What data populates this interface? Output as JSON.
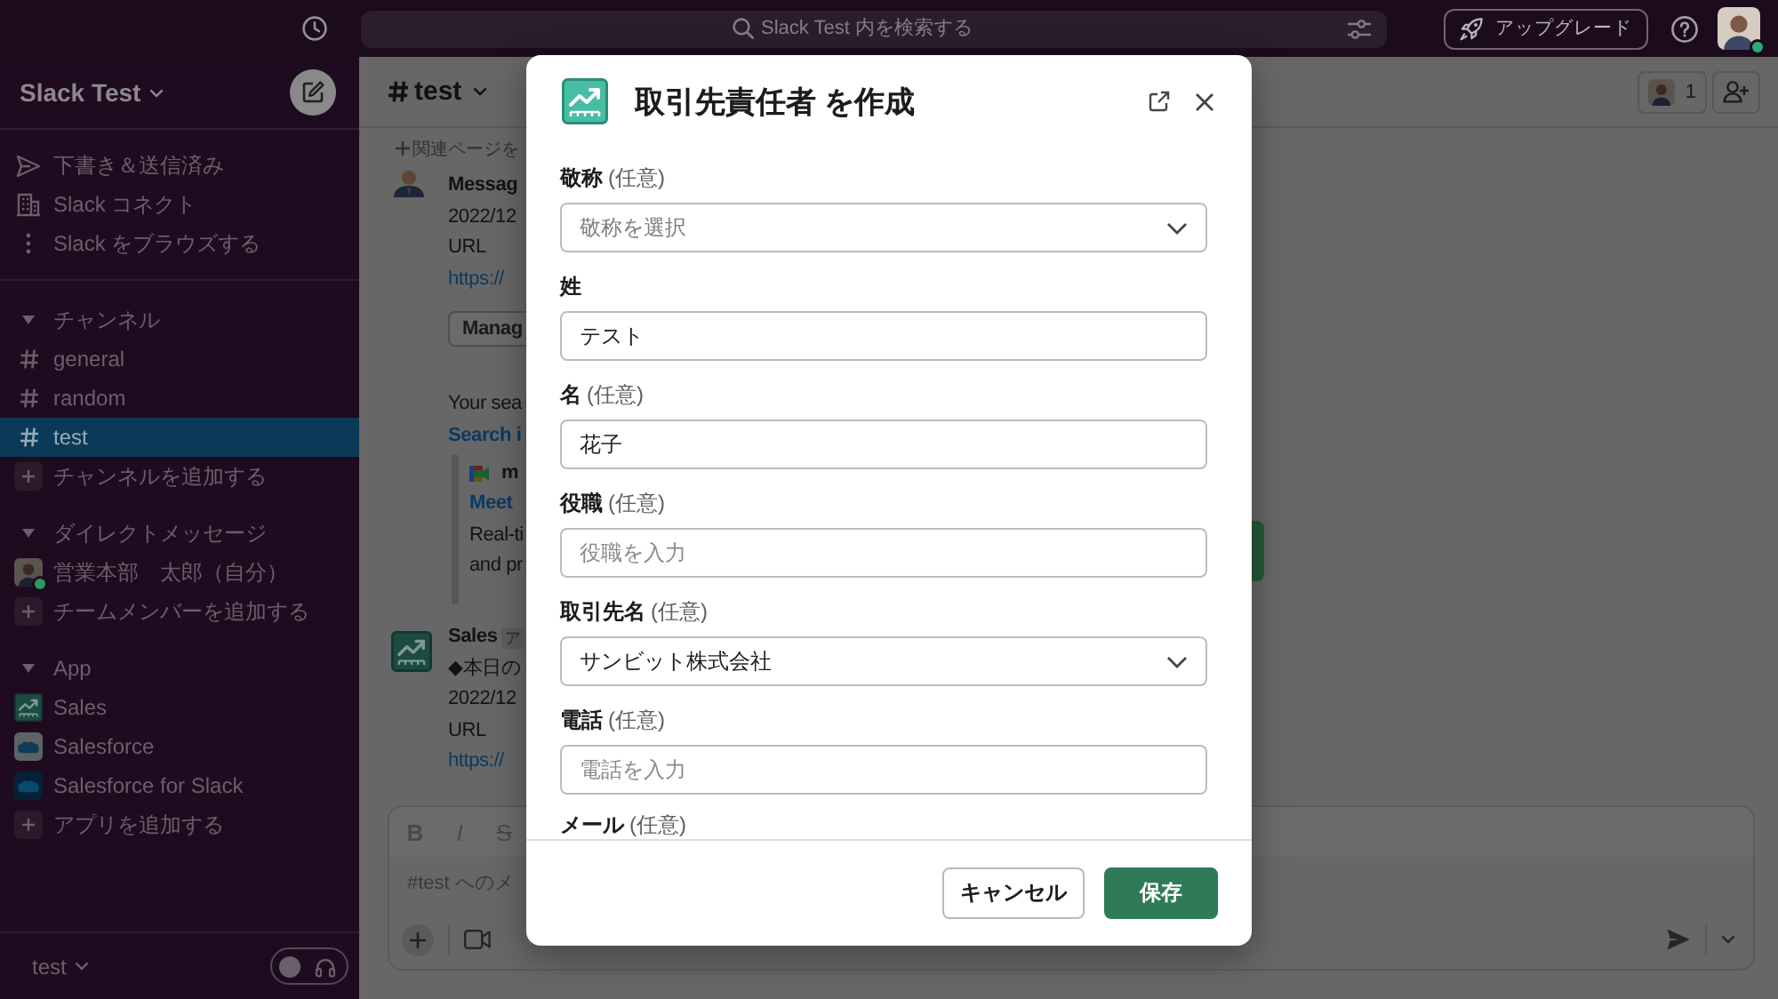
{
  "topbar": {
    "search": {
      "placeholder": "Slack Test 内を検索する"
    },
    "upgrade_button": "アップグレード",
    "user": {
      "online": true
    }
  },
  "sidebar": {
    "workspace": "Slack Test",
    "nav": [
      {
        "label": "下書き＆送信済み",
        "selected": false
      },
      {
        "label": "Slack コネクト",
        "selected": false
      },
      {
        "label": "Slack をブラウズする",
        "selected": false
      }
    ],
    "sections": [
      {
        "title": "チャンネル",
        "expanded": true,
        "items": [
          {
            "kind": "channel",
            "label": "general",
            "selected": false
          },
          {
            "kind": "channel",
            "label": "random",
            "selected": false
          },
          {
            "kind": "channel",
            "label": "test",
            "selected": true
          },
          {
            "kind": "add",
            "label": "チャンネルを追加する",
            "selected": false
          }
        ]
      },
      {
        "title": "ダイレクトメッセージ",
        "expanded": true,
        "items": [
          {
            "kind": "user",
            "label": "営業本部　太郎（自分）",
            "online": true,
            "selected": false
          },
          {
            "kind": "add",
            "label": "チームメンバーを追加する",
            "selected": false
          }
        ]
      },
      {
        "title": "App",
        "expanded": true,
        "items": [
          {
            "kind": "app",
            "label": "Sales",
            "selected": false
          },
          {
            "kind": "app",
            "label": "Salesforce",
            "selected": false
          },
          {
            "kind": "app",
            "label": "Salesforce for Slack",
            "selected": false
          },
          {
            "kind": "add",
            "label": "アプリを追加する",
            "selected": false
          }
        ]
      }
    ],
    "footer": {
      "label": "test",
      "huddle_on": false
    }
  },
  "channel": {
    "title": "test",
    "member_count": "1",
    "bookmark": "関連ページを",
    "messages": [
      {
        "sender": "Messag",
        "parts": [
          {
            "kind": "text",
            "text": "2022/12"
          },
          {
            "kind": "text",
            "text": "URL"
          },
          {
            "kind": "link",
            "text": "https://"
          },
          {
            "kind": "button",
            "text": "Manag"
          },
          {
            "kind": "text",
            "text": "Your sea"
          },
          {
            "kind": "strong_link",
            "text": "Search i"
          },
          {
            "kind": "attachment",
            "title": "m",
            "link": "Meet",
            "lines": [
              "Real-ti",
              "and pr"
            ]
          }
        ]
      },
      {
        "sender": "Sales",
        "badge": "ア",
        "parts": [
          {
            "kind": "text",
            "text": "◆本日の"
          },
          {
            "kind": "text",
            "text": "2022/12"
          },
          {
            "kind": "text",
            "text": "URL"
          },
          {
            "kind": "link",
            "text": "https://"
          }
        ]
      }
    ],
    "composer": {
      "format_buttons": [
        {
          "kind": "bold",
          "label": "B"
        },
        {
          "kind": "italic",
          "label": "I"
        },
        {
          "kind": "strike",
          "label": "S"
        }
      ],
      "placeholder": "#test へのメ"
    }
  },
  "modal": {
    "title": "取引先責任者 を作成",
    "fields": [
      {
        "kind": "select",
        "label": "敬称",
        "optional": "(任意)",
        "placeholder": "敬称を選択"
      },
      {
        "kind": "text",
        "label": "姓",
        "value": "テスト"
      },
      {
        "kind": "text",
        "label": "名",
        "optional": "(任意)",
        "value": "花子"
      },
      {
        "kind": "text",
        "label": "役職",
        "optional": "(任意)",
        "placeholder": "役職を入力"
      },
      {
        "kind": "select",
        "label": "取引先名",
        "optional": "(任意)",
        "value": "サンビット株式会社"
      },
      {
        "kind": "text",
        "label": "電話",
        "optional": "(任意)",
        "placeholder": "電話を入力"
      },
      {
        "kind": "label",
        "label": "メール",
        "optional": "(任意)"
      }
    ],
    "buttons": [
      {
        "kind": "secondary",
        "label": "キャンセル"
      },
      {
        "kind": "primary",
        "label": "保存"
      }
    ]
  }
}
